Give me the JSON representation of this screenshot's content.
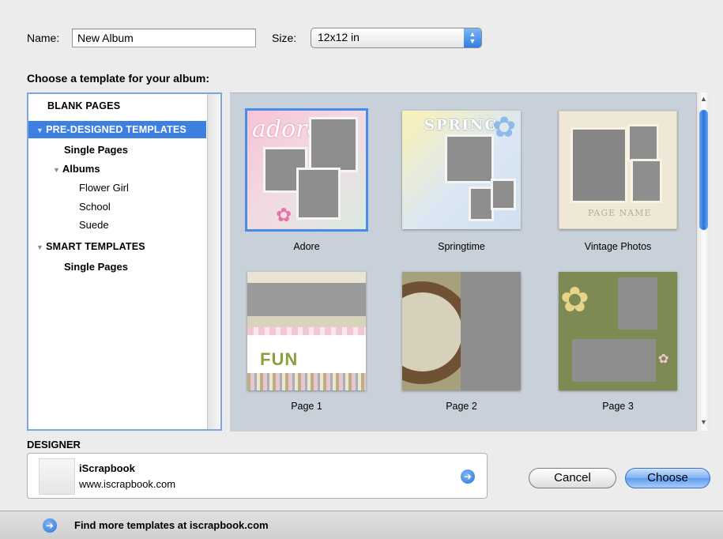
{
  "form": {
    "name_label": "Name:",
    "name_value": "New Album",
    "size_label": "Size:",
    "size_value": "12x12 in"
  },
  "template_title": "Choose a template for your album:",
  "sidebar": {
    "items": [
      {
        "label": "BLANK PAGES"
      },
      {
        "label": "PRE-DESIGNED TEMPLATES"
      },
      {
        "label": "Single Pages"
      },
      {
        "label": "Albums"
      },
      {
        "label": "Flower Girl"
      },
      {
        "label": "School"
      },
      {
        "label": "Suede"
      },
      {
        "label": "SMART TEMPLATES"
      },
      {
        "label": "Single Pages"
      }
    ]
  },
  "templates": [
    {
      "caption": "Adore",
      "title_art": "adore"
    },
    {
      "caption": "Springtime",
      "title_art": "SPRING"
    },
    {
      "caption": "Vintage Photos",
      "title_art": "PAGE NAME"
    },
    {
      "caption": "Page 1",
      "title_art": "FUN"
    },
    {
      "caption": "Page 2",
      "title_art": ""
    },
    {
      "caption": "Page 3",
      "title_art": ""
    }
  ],
  "designer": {
    "label": "DESIGNER",
    "name": "iScrapbook",
    "url": "www.iscrapbook.com"
  },
  "buttons": {
    "cancel": "Cancel",
    "choose": "Choose"
  },
  "footer": {
    "link_text": "Find more templates at iscrapbook.com"
  },
  "colors": {
    "selection": "#3d80df",
    "grid_bg": "#c8d0d9",
    "accent": "#4a8ae8"
  }
}
